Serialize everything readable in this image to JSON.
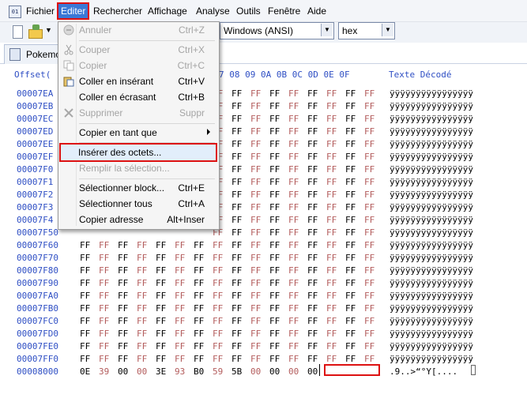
{
  "menubar": {
    "app_icon_text": "01",
    "items": [
      "Fichier",
      "Editer",
      "Rechercher",
      "Affichage",
      "Analyse",
      "Outils",
      "Fenêtre",
      "Aide"
    ]
  },
  "toolbar": {
    "encoding": "Windows (ANSI)",
    "mode": "hex"
  },
  "tab": {
    "label": "Pokemo"
  },
  "hex": {
    "header_offset": "Offset(",
    "header_cols": "7 08 09 0A 0B 0C 0D 0E 0F",
    "header_decoded": "Texte Décodé",
    "rows": [
      {
        "offset": "00007EA",
        "bytes": [
          "FF",
          "FF",
          "FF",
          "FF",
          "FF",
          "FF",
          "FF",
          "FF",
          "FF"
        ],
        "text": "ÿÿÿÿÿÿÿÿÿÿÿÿÿÿÿÿ"
      },
      {
        "offset": "00007EB",
        "bytes": [
          "FF",
          "FF",
          "FF",
          "FF",
          "FF",
          "FF",
          "FF",
          "FF",
          "FF"
        ],
        "text": "ÿÿÿÿÿÿÿÿÿÿÿÿÿÿÿÿ"
      },
      {
        "offset": "00007EC",
        "bytes": [
          "FF",
          "FF",
          "FF",
          "FF",
          "FF",
          "FF",
          "FF",
          "FF",
          "FF"
        ],
        "text": "ÿÿÿÿÿÿÿÿÿÿÿÿÿÿÿÿ"
      },
      {
        "offset": "00007ED",
        "bytes": [
          "FF",
          "FF",
          "FF",
          "FF",
          "FF",
          "FF",
          "FF",
          "FF",
          "FF"
        ],
        "text": "ÿÿÿÿÿÿÿÿÿÿÿÿÿÿÿÿ"
      },
      {
        "offset": "00007EE",
        "bytes": [
          "FF",
          "FF",
          "FF",
          "FF",
          "FF",
          "FF",
          "FF",
          "FF",
          "FF"
        ],
        "text": "ÿÿÿÿÿÿÿÿÿÿÿÿÿÿÿÿ"
      },
      {
        "offset": "00007EF",
        "bytes": [
          "FF",
          "FF",
          "FF",
          "FF",
          "FF",
          "FF",
          "FF",
          "FF",
          "FF"
        ],
        "text": "ÿÿÿÿÿÿÿÿÿÿÿÿÿÿÿÿ"
      },
      {
        "offset": "00007F0",
        "bytes": [
          "FF",
          "FF",
          "FF",
          "FF",
          "FF",
          "FF",
          "FF",
          "FF",
          "FF"
        ],
        "text": "ÿÿÿÿÿÿÿÿÿÿÿÿÿÿÿÿ"
      },
      {
        "offset": "00007F1",
        "bytes": [
          "FF",
          "FF",
          "FF",
          "FF",
          "FF",
          "FF",
          "FF",
          "FF",
          "FF"
        ],
        "text": "ÿÿÿÿÿÿÿÿÿÿÿÿÿÿÿÿ"
      },
      {
        "offset": "00007F2",
        "bytes": [
          "FF",
          "FF",
          "FF",
          "FF",
          "FF",
          "FF",
          "FF",
          "FF",
          "FF"
        ],
        "text": "ÿÿÿÿÿÿÿÿÿÿÿÿÿÿÿÿ"
      },
      {
        "offset": "00007F3",
        "bytes": [
          "FF",
          "FF",
          "FF",
          "FF",
          "FF",
          "FF",
          "FF",
          "FF",
          "FF"
        ],
        "text": "ÿÿÿÿÿÿÿÿÿÿÿÿÿÿÿÿ"
      },
      {
        "offset": "00007F4",
        "bytes": [
          "FF",
          "FF",
          "FF",
          "FF",
          "FF",
          "FF",
          "FF",
          "FF",
          "FF"
        ],
        "text": "ÿÿÿÿÿÿÿÿÿÿÿÿÿÿÿÿ"
      },
      {
        "offset": "00007F50",
        "bytes": [
          "FF",
          "FF",
          "FF",
          "FF",
          "FF",
          "FF",
          "FF",
          "FF",
          "FF"
        ],
        "text": "ÿÿÿÿÿÿÿÿÿÿÿÿÿÿÿÿ"
      },
      {
        "offset": "00007F60",
        "bytes": [
          "FF",
          "FF",
          "FF",
          "FF",
          "FF",
          "FF",
          "FF",
          "FF",
          "FF",
          "FF",
          "FF",
          "FF",
          "FF",
          "FF",
          "FF",
          "FF"
        ],
        "text": "ÿÿÿÿÿÿÿÿÿÿÿÿÿÿÿÿ"
      },
      {
        "offset": "00007F70",
        "bytes": [
          "FF",
          "FF",
          "FF",
          "FF",
          "FF",
          "FF",
          "FF",
          "FF",
          "FF",
          "FF",
          "FF",
          "FF",
          "FF",
          "FF",
          "FF",
          "FF"
        ],
        "text": "ÿÿÿÿÿÿÿÿÿÿÿÿÿÿÿÿ"
      },
      {
        "offset": "00007F80",
        "bytes": [
          "FF",
          "FF",
          "FF",
          "FF",
          "FF",
          "FF",
          "FF",
          "FF",
          "FF",
          "FF",
          "FF",
          "FF",
          "FF",
          "FF",
          "FF",
          "FF"
        ],
        "text": "ÿÿÿÿÿÿÿÿÿÿÿÿÿÿÿÿ"
      },
      {
        "offset": "00007F90",
        "bytes": [
          "FF",
          "FF",
          "FF",
          "FF",
          "FF",
          "FF",
          "FF",
          "FF",
          "FF",
          "FF",
          "FF",
          "FF",
          "FF",
          "FF",
          "FF",
          "FF"
        ],
        "text": "ÿÿÿÿÿÿÿÿÿÿÿÿÿÿÿÿ"
      },
      {
        "offset": "00007FA0",
        "bytes": [
          "FF",
          "FF",
          "FF",
          "FF",
          "FF",
          "FF",
          "FF",
          "FF",
          "FF",
          "FF",
          "FF",
          "FF",
          "FF",
          "FF",
          "FF",
          "FF"
        ],
        "text": "ÿÿÿÿÿÿÿÿÿÿÿÿÿÿÿÿ"
      },
      {
        "offset": "00007FB0",
        "bytes": [
          "FF",
          "FF",
          "FF",
          "FF",
          "FF",
          "FF",
          "FF",
          "FF",
          "FF",
          "FF",
          "FF",
          "FF",
          "FF",
          "FF",
          "FF",
          "FF"
        ],
        "text": "ÿÿÿÿÿÿÿÿÿÿÿÿÿÿÿÿ"
      },
      {
        "offset": "00007FC0",
        "bytes": [
          "FF",
          "FF",
          "FF",
          "FF",
          "FF",
          "FF",
          "FF",
          "FF",
          "FF",
          "FF",
          "FF",
          "FF",
          "FF",
          "FF",
          "FF",
          "FF"
        ],
        "text": "ÿÿÿÿÿÿÿÿÿÿÿÿÿÿÿÿ"
      },
      {
        "offset": "00007FD0",
        "bytes": [
          "FF",
          "FF",
          "FF",
          "FF",
          "FF",
          "FF",
          "FF",
          "FF",
          "FF",
          "FF",
          "FF",
          "FF",
          "FF",
          "FF",
          "FF",
          "FF"
        ],
        "text": "ÿÿÿÿÿÿÿÿÿÿÿÿÿÿÿÿ"
      },
      {
        "offset": "00007FE0",
        "bytes": [
          "FF",
          "FF",
          "FF",
          "FF",
          "FF",
          "FF",
          "FF",
          "FF",
          "FF",
          "FF",
          "FF",
          "FF",
          "FF",
          "FF",
          "FF",
          "FF"
        ],
        "text": "ÿÿÿÿÿÿÿÿÿÿÿÿÿÿÿÿ"
      },
      {
        "offset": "00007FF0",
        "bytes": [
          "FF",
          "FF",
          "FF",
          "FF",
          "FF",
          "FF",
          "FF",
          "FF",
          "FF",
          "FF",
          "FF",
          "FF",
          "FF",
          "FF",
          "FF",
          "FF"
        ],
        "text": "ÿÿÿÿÿÿÿÿÿÿÿÿÿÿÿÿ"
      },
      {
        "offset": "00008000",
        "bytes": [
          "0E",
          "39",
          "00",
          "00",
          "3E",
          "93",
          "B0",
          "59",
          "5B",
          "00",
          "00",
          "00",
          "00"
        ],
        "text": ".9..>“°Y[...."
      }
    ]
  },
  "menu": {
    "items": [
      {
        "label": "Annuler",
        "shortcut": "Ctrl+Z",
        "state": "disabled",
        "icon": "undo-icon"
      },
      {
        "label": "Couper",
        "shortcut": "Ctrl+X",
        "state": "disabled",
        "icon": "scissors-icon"
      },
      {
        "label": "Copier",
        "shortcut": "Ctrl+C",
        "state": "disabled",
        "icon": "copy-icon"
      },
      {
        "label": "Coller en insérant",
        "shortcut": "Ctrl+V",
        "state": "enabled",
        "icon": "paste-icon"
      },
      {
        "label": "Coller en écrasant",
        "shortcut": "Ctrl+B",
        "state": "enabled",
        "icon": ""
      },
      {
        "label": "Supprimer",
        "shortcut": "Suppr",
        "state": "disabled",
        "icon": "delete-x-icon"
      },
      {
        "label": "Copier en tant que",
        "shortcut": "",
        "state": "enabled",
        "icon": "",
        "submenu": true
      },
      {
        "label": "Insérer des octets...",
        "shortcut": "",
        "state": "highlighted",
        "icon": ""
      },
      {
        "label": "Remplir la sélection...",
        "shortcut": "",
        "state": "disabled",
        "icon": ""
      },
      {
        "label": "Sélectionner block...",
        "shortcut": "Ctrl+E",
        "state": "enabled",
        "icon": ""
      },
      {
        "label": "Sélectionner tous",
        "shortcut": "Ctrl+A",
        "state": "enabled",
        "icon": ""
      },
      {
        "label": "Copier adresse",
        "shortcut": "Alt+Inser",
        "state": "enabled",
        "icon": ""
      }
    ]
  },
  "colors": {
    "offset_blue": "#2f4fc4",
    "byte_dim": "#b35c5c",
    "highlight_red": "#dd1111",
    "menu_bg": "#f5f5f5"
  }
}
